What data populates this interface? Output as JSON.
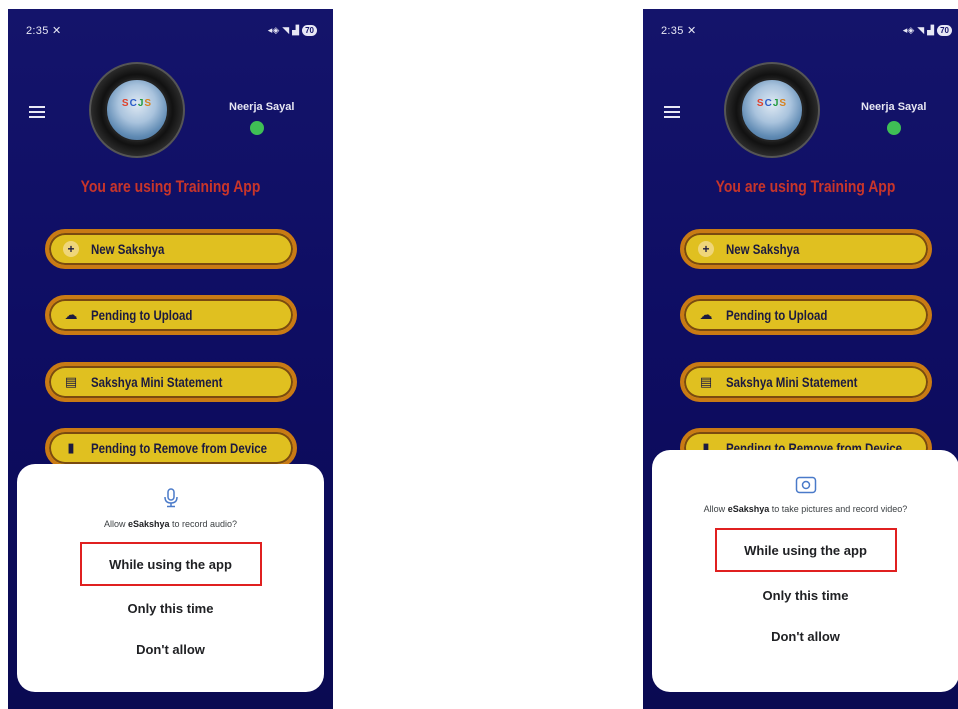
{
  "status_bar": {
    "time": "2:35",
    "battery": "70"
  },
  "user": {
    "name": "Neerja Sayal"
  },
  "banner": "You are using Training App",
  "menu": [
    {
      "label": "New Sakshya",
      "icon": "plus-icon"
    },
    {
      "label": "Pending to Upload",
      "icon": "cloud-upload-icon"
    },
    {
      "label": "Sakshya Mini Statement",
      "icon": "document-icon"
    },
    {
      "label": "Pending to Remove from Device",
      "icon": "trash-icon"
    }
  ],
  "logo": {
    "letters": [
      "S",
      "C",
      "J",
      "S"
    ]
  },
  "dialogs": {
    "left": {
      "icon": "microphone-icon",
      "prefix": "Allow ",
      "app": "eSakshya",
      "suffix": " to record audio?",
      "options": [
        "While using the app",
        "Only this time",
        "Don't allow"
      ]
    },
    "right": {
      "icon": "camera-icon",
      "prefix": "Allow ",
      "app": "eSakshya",
      "suffix": " to take pictures and record video?",
      "options": [
        "While using the app",
        "Only this time",
        "Don't allow"
      ]
    }
  },
  "colors": {
    "background": "#0e0d63",
    "button_fill": "#e0c020",
    "button_border": "#c97a14",
    "banner": "#c8352a",
    "highlight": "#e02020",
    "online": "#3fbf55"
  }
}
